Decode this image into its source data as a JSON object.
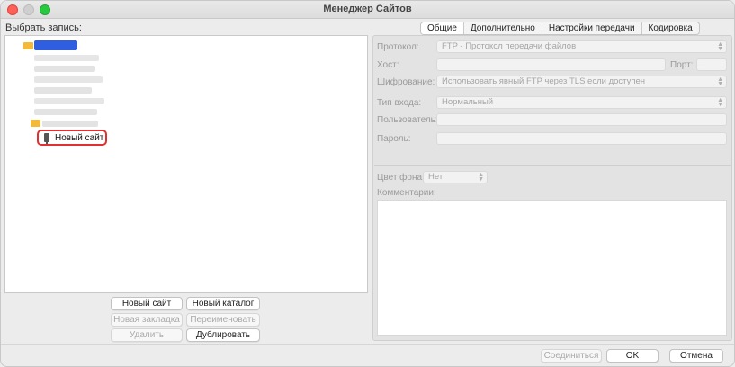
{
  "window": {
    "title": "Менеджер Сайтов"
  },
  "left": {
    "label": "Выбрать запись:",
    "selected_item": "Новый сайт"
  },
  "buttons": {
    "new_site": "Новый сайт",
    "new_folder": "Новый каталог",
    "new_bookmark": "Новая закладка",
    "rename": "Переименовать",
    "delete": "Удалить",
    "duplicate": "Дублировать"
  },
  "tabs": [
    "Общие",
    "Дополнительно",
    "Настройки передачи",
    "Кодировка"
  ],
  "form": {
    "protocol_label": "Протокол:",
    "protocol_value": "FTP - Протокол передачи файлов",
    "host_label": "Хост:",
    "host_value": "",
    "port_label": "Порт:",
    "port_value": "",
    "encryption_label": "Шифрование:",
    "encryption_value": "Использовать явный FTP через TLS если доступен",
    "logon_label": "Тип входа:",
    "logon_value": "Нормальный",
    "user_label": "Пользователь:",
    "password_label": "Пароль:",
    "bgcolor_label": "Цвет фона:",
    "bgcolor_value": "Нет",
    "comments_label": "Комментарии:"
  },
  "footer": {
    "connect": "Соединиться",
    "ok": "OK",
    "cancel": "Отмена"
  },
  "colors": {
    "highlight_border": "#e03030",
    "selection_blue": "#2f5fe0",
    "folder": "#f5b93a"
  }
}
